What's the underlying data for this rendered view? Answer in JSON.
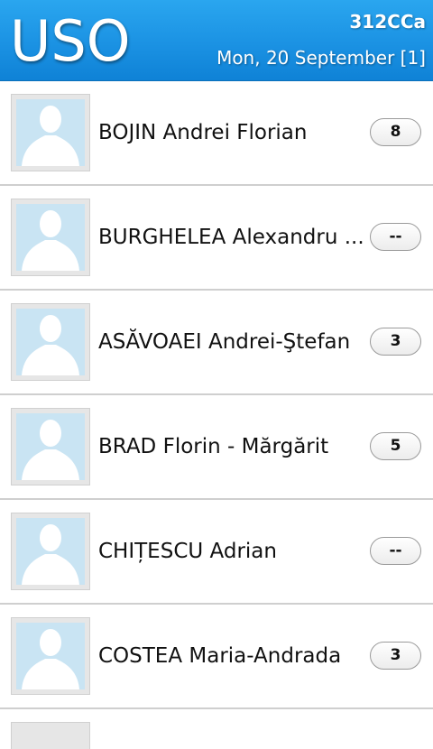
{
  "header": {
    "title": "USO",
    "group": "312CCa",
    "date": "Mon, 20 September [1]"
  },
  "students": [
    {
      "name": "BOJIN Andrei Florian",
      "score": "8"
    },
    {
      "name": "BURGHELEA Alexandru ...",
      "score": "--"
    },
    {
      "name": "ASĂVOAEI Andrei-Ştefan",
      "score": "3"
    },
    {
      "name": "BRAD Florin - Mărgărit",
      "score": "5"
    },
    {
      "name": "CHIȚESCU Adrian",
      "score": "--"
    },
    {
      "name": "COSTEA Maria-Andrada",
      "score": "3"
    }
  ],
  "icons": {
    "avatar": "default-person-icon"
  },
  "colors": {
    "header_bg": "#1b92e3",
    "avatar_bg": "#c9e4f3",
    "separator": "#cfcfcf"
  }
}
